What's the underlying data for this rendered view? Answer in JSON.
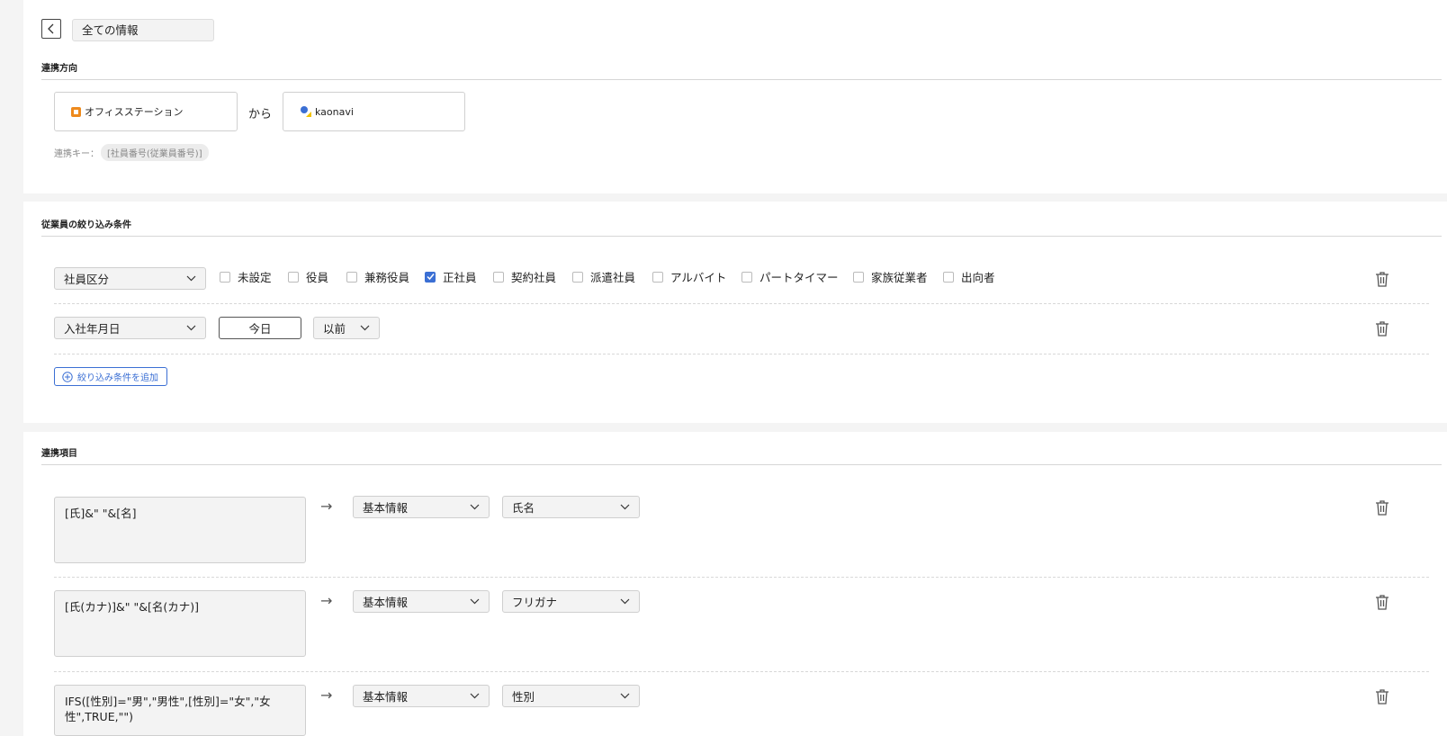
{
  "header": {
    "back_icon": "chevron-left-icon",
    "breadcrumb": "全ての情報"
  },
  "direction": {
    "title": "連携方向",
    "source": {
      "name": "オフィスステーション",
      "logo_color": "#ee8a1d"
    },
    "connector": "から",
    "target": {
      "name": "kaonavi",
      "logo_colors": [
        "#3b6fd4",
        "#f2c200"
      ]
    },
    "key_label": "連携キー：",
    "key_value": "[社員番号(従業員番号)]"
  },
  "filter": {
    "title": "従業員の絞り込み条件",
    "rows": [
      {
        "field": "社員区分",
        "options": [
          {
            "label": "未設定",
            "checked": false
          },
          {
            "label": "役員",
            "checked": false
          },
          {
            "label": "兼務役員",
            "checked": false
          },
          {
            "label": "正社員",
            "checked": true
          },
          {
            "label": "契約社員",
            "checked": false
          },
          {
            "label": "派遣社員",
            "checked": false
          },
          {
            "label": "アルバイト",
            "checked": false
          },
          {
            "label": "パートタイマー",
            "checked": false
          },
          {
            "label": "家族従業者",
            "checked": false
          },
          {
            "label": "出向者",
            "checked": false
          }
        ]
      },
      {
        "field": "入社年月日",
        "date_value": "今日",
        "comparator": "以前"
      }
    ],
    "add_label": "絞り込み条件を追加"
  },
  "mapping": {
    "title": "連携項目",
    "rows": [
      {
        "formula": "[氏]&\" \"&[名]",
        "category": "基本情報",
        "item": "氏名"
      },
      {
        "formula": "[氏(カナ)]&\" \"&[名(カナ)]",
        "category": "基本情報",
        "item": "フリガナ"
      },
      {
        "formula": "IFS([性別]=\"男\",\"男性\",[性別]=\"女\",\"女性\",TRUE,\"\")",
        "category": "基本情報",
        "item": "性別"
      }
    ]
  },
  "accent_color": "#3b6fd4"
}
